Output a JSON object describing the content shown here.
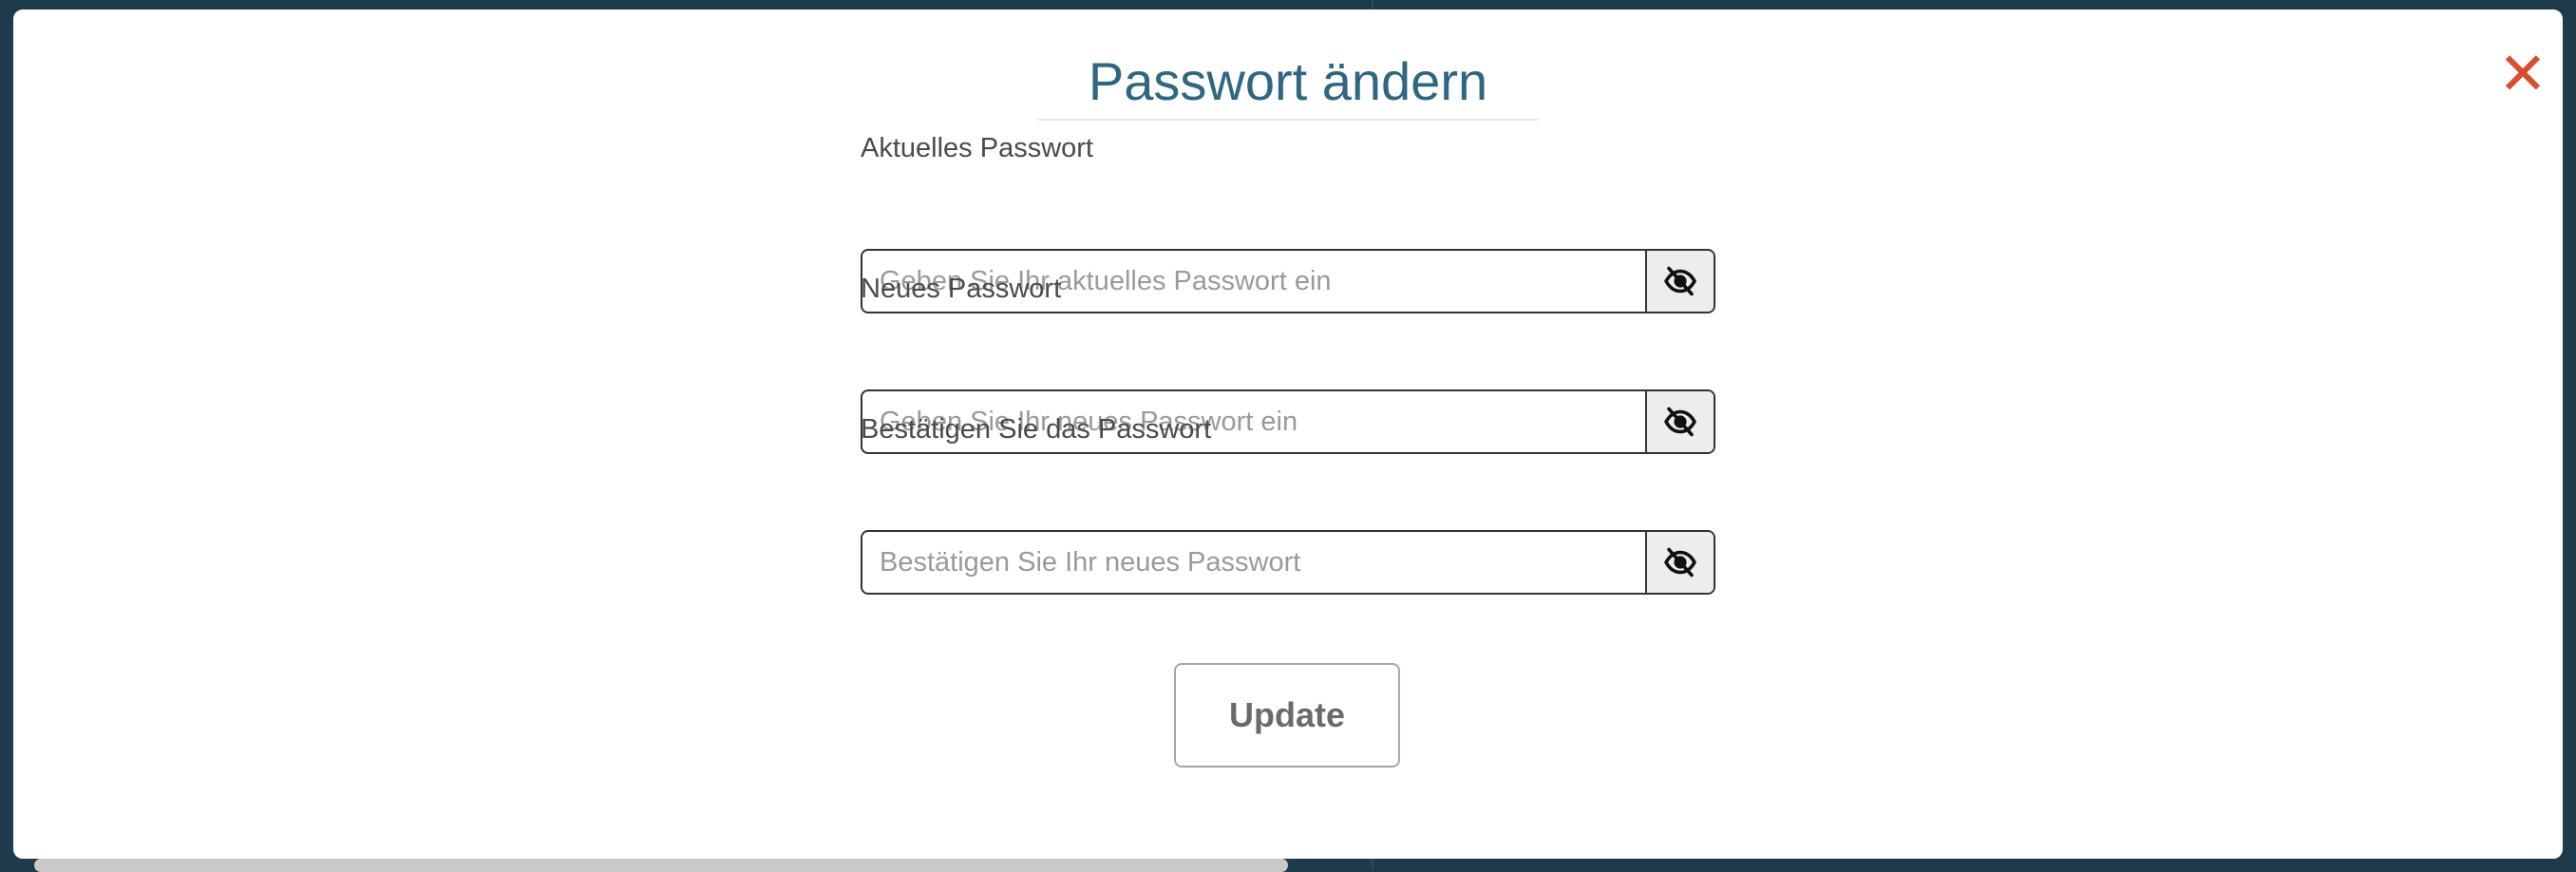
{
  "dialog": {
    "title": "Passwort ändern",
    "close_glyph": "✕",
    "close_icon": "close-icon"
  },
  "form": {
    "fields": [
      {
        "label": "Aktuelles Passwort",
        "value": "",
        "placeholder": "Geben Sie Ihr aktuelles Passwort ein",
        "icon": "eye-slash-icon"
      },
      {
        "label": "Neues Passwort",
        "value": "",
        "placeholder": "Geben Sie Ihr neues Passwort ein",
        "icon": "eye-slash-icon"
      },
      {
        "label": "Bestätigen Sie das Passwort",
        "value": "",
        "placeholder": "Bestätigen Sie Ihr neues Passwort",
        "icon": "eye-slash-icon"
      }
    ],
    "submit_label": "Update"
  },
  "colors": {
    "backdrop": "#1d3a4a",
    "title": "#2f6680",
    "close": "#d64f2e",
    "border": "#333333",
    "toggle_bg": "#ededed"
  }
}
